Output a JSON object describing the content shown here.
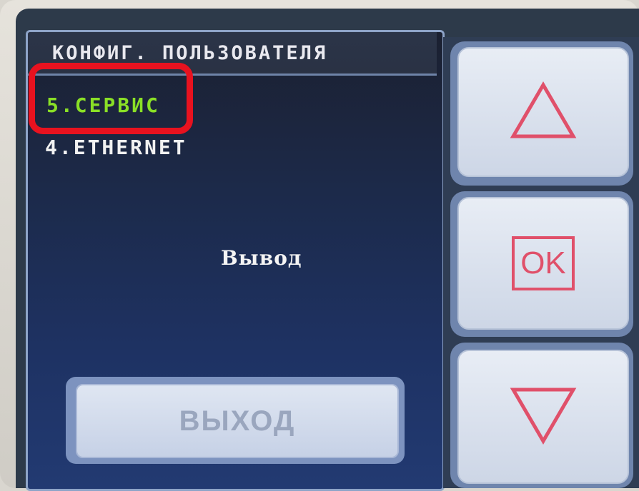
{
  "screen": {
    "title": "КОНФИГ. ПОЛЬЗОВАТЕЛЯ",
    "menu_items": [
      {
        "label": "5.СЕРВИС",
        "selected": true
      },
      {
        "label": "4.ETHERNET",
        "selected": false
      }
    ],
    "center_label": "Вывод",
    "exit_button_label": "ВЫХОД"
  },
  "hardware_buttons": {
    "up_icon": "triangle-up-icon",
    "ok_label": "OK",
    "down_icon": "triangle-down-icon"
  },
  "colors": {
    "selected_text": "#8ae026",
    "highlight_outline": "#e8121f",
    "button_glyph": "#e0506a"
  }
}
